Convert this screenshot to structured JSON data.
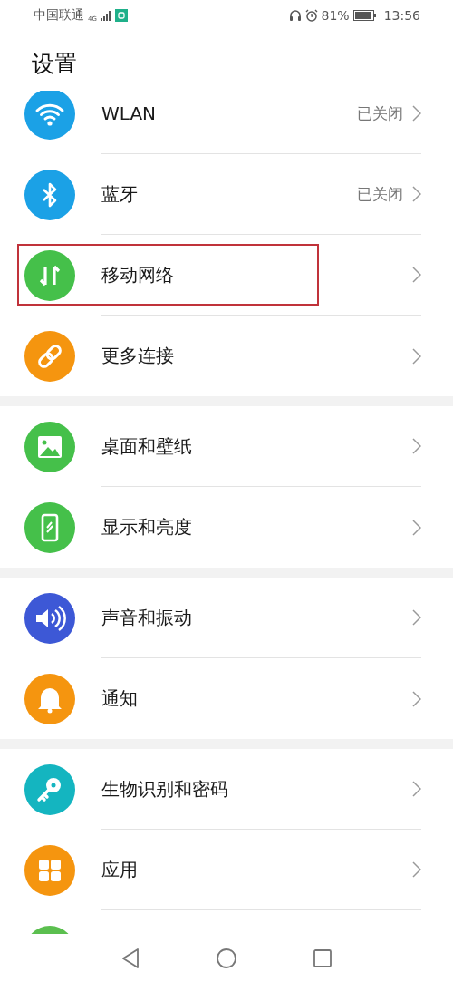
{
  "status_bar": {
    "carrier": "中国联通",
    "network": "4G",
    "battery_percent": "81%",
    "time": "13:56"
  },
  "title": "设置",
  "groups": [
    {
      "items": [
        {
          "kind": "wifi",
          "label": "WLAN",
          "value": "已关闭",
          "highlighted": false
        },
        {
          "kind": "bluetooth",
          "label": "蓝牙",
          "value": "已关闭",
          "highlighted": false
        },
        {
          "kind": "data",
          "label": "移动网络",
          "highlighted": true
        },
        {
          "kind": "link",
          "label": "更多连接",
          "highlighted": false
        }
      ]
    },
    {
      "items": [
        {
          "kind": "image",
          "label": "桌面和壁纸",
          "highlighted": false
        },
        {
          "kind": "phone",
          "label": "显示和亮度",
          "highlighted": false
        }
      ]
    },
    {
      "items": [
        {
          "kind": "sound",
          "label": "声音和振动",
          "highlighted": false
        },
        {
          "kind": "bell",
          "label": "通知",
          "highlighted": false
        }
      ]
    },
    {
      "items": [
        {
          "kind": "key",
          "label": "生物识别和密码",
          "highlighted": false
        },
        {
          "kind": "grid",
          "label": "应用",
          "highlighted": false
        },
        {
          "kind": "circle"
        }
      ]
    }
  ]
}
